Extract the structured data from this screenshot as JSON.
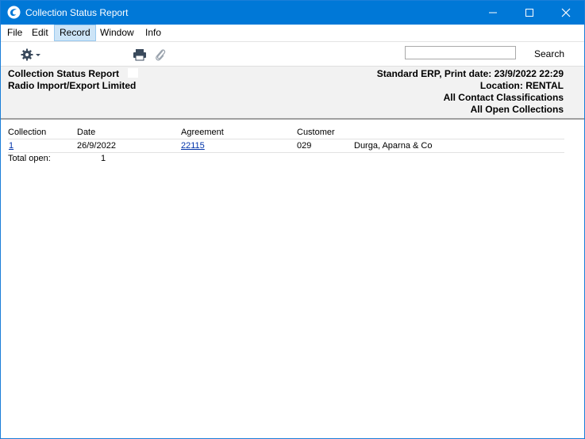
{
  "window": {
    "title": "Collection Status Report"
  },
  "menu": {
    "items": [
      "File",
      "Edit",
      "Record",
      "Window",
      "Info"
    ],
    "active": "Record"
  },
  "toolbar": {
    "search_value": "",
    "search_label": "Search"
  },
  "report": {
    "title": "Collection Status Report",
    "company": "Radio Import/Export Limited",
    "right_lines": [
      "Standard ERP, Print date: 23/9/2022 22:29",
      "Location: RENTAL",
      "All Contact Classifications",
      "All Open Collections"
    ]
  },
  "table": {
    "headers": [
      "Collection",
      "Date",
      "Agreement",
      "Customer"
    ],
    "rows": [
      {
        "collection": "1",
        "date": "26/9/2022",
        "agreement": "22115",
        "customer_code": "029",
        "customer_name": "Durga, Aparna & Co"
      }
    ],
    "total_label": "Total open:",
    "total_value": "1"
  },
  "colors": {
    "titlebar": "#0078d7",
    "header_bg": "#f2f2f2",
    "menu_active": "#cce4f7"
  }
}
